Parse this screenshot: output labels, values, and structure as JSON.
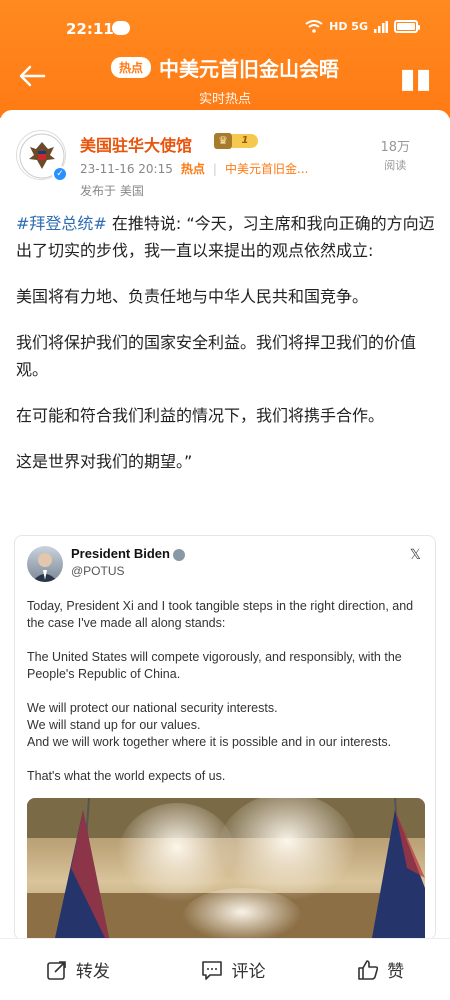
{
  "status_bar": {
    "time": "22:11",
    "network": "HD 5G",
    "battery_level": 0.9
  },
  "header": {
    "badge": "热点",
    "title": "中美元首旧金山会晤",
    "subtitle": "实时热点"
  },
  "post": {
    "author": "美国驻华大使馆",
    "level": "1",
    "timestamp": "23-11-16 20:15",
    "hot_label": "热点",
    "topic": "中美元首旧金...",
    "location": "发布于 美国",
    "reads_count": "18万",
    "reads_label": "阅读",
    "hashtag": "#拜登总统#",
    "paragraphs": [
      " 在推特说: “今天，习主席和我向正确的方向迈出了切实的步伐，我一直以来提出的观点依然成立:",
      "美国将有力地、负责任地与中华人民共和国竞争。",
      "我们将保护我们的国家安全利益。我们将捍卫我们的价值观。",
      "在可能和符合我们利益的情况下，我们将携手合作。",
      "这是世界对我们的期望。”"
    ]
  },
  "tweet": {
    "name": "President Biden",
    "handle": "@POTUS",
    "lines": [
      "Today, President Xi and I took tangible steps in the right direction, and the case I've made all along stands:",
      "The United States will compete vigorously, and responsibly, with the People's Republic of China.",
      "We will protect our national security interests.",
      "We will stand up for our values.",
      "And we will work together where it is possible and in our interests.",
      "That's what the world expects of us."
    ]
  },
  "actions": {
    "repost": "转发",
    "comment": "评论",
    "like": "赞"
  },
  "colors": {
    "brand_orange": "#ff7a14",
    "username": "#e8540c",
    "hashtag": "#2f6db5"
  }
}
